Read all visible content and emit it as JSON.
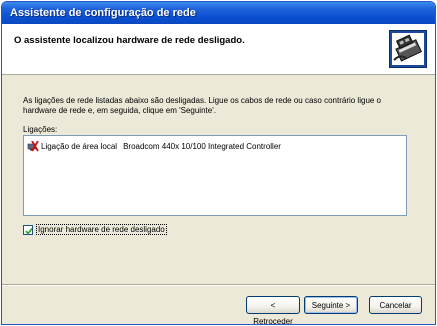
{
  "window": {
    "title": "Assistente de configuração de rede"
  },
  "header": {
    "title": "O assistente localizou hardware de rede desligado.",
    "icon": "network-hardware-icon"
  },
  "body": {
    "intro": "As ligações de rede listadas abaixo são desligadas. Ligue os cabos de rede ou caso contrário ligue o hardware de rede e, em seguida, clique em 'Seguinte'.",
    "connections_label": "Ligações:",
    "connections": [
      {
        "name": "Ligação de área local",
        "device": "Broadcom 440x 10/100 Integrated Controller",
        "icon": "disconnected-network-icon"
      }
    ],
    "ignore_checkbox": {
      "label": "Ignorar hardware de rede desligado",
      "checked": true
    }
  },
  "buttons": {
    "back": "< Retroceder",
    "next": "Seguinte >",
    "cancel": "Cancelar"
  }
}
